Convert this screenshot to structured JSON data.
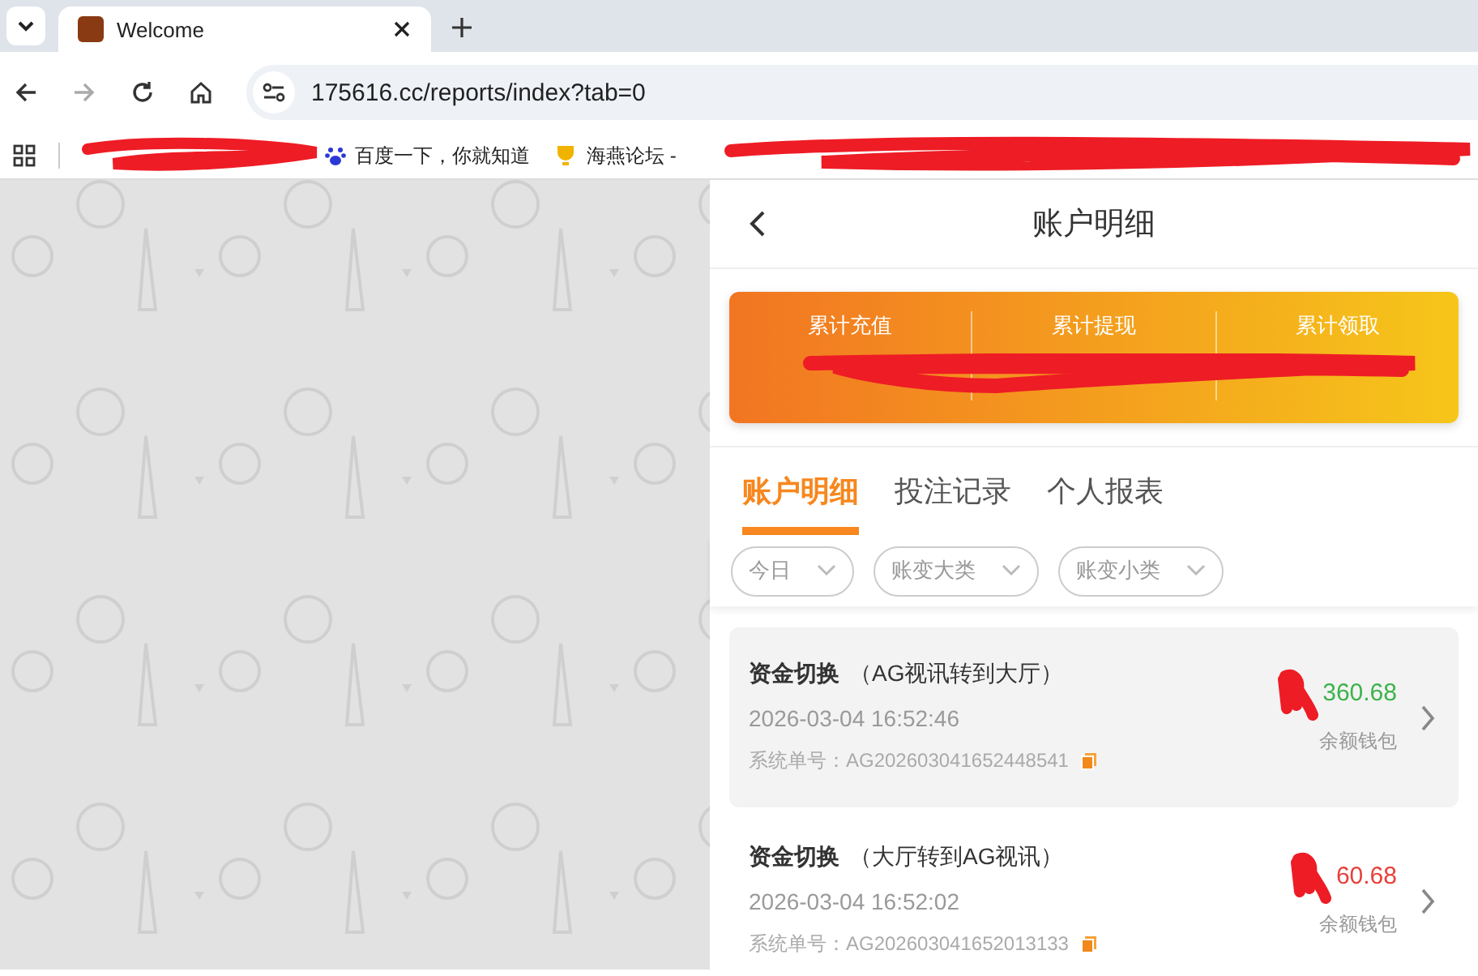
{
  "browser": {
    "tabs": [
      {
        "title": "Welcome",
        "selected": true
      }
    ],
    "url": "175616.cc/reports/index?tab=0",
    "bookmarks": [
      {
        "label": "百度一下，你就知道",
        "kind": "paw"
      },
      {
        "label": "海燕论坛 -",
        "kind": "trophy"
      }
    ]
  },
  "page": {
    "title": "账户明细",
    "summary": [
      {
        "label": "累计充值"
      },
      {
        "label": "累计提现"
      },
      {
        "label": "累计领取"
      }
    ],
    "tabs": [
      {
        "label": "账户明细",
        "selected": true
      },
      {
        "label": "投注记录",
        "selected": false
      },
      {
        "label": "个人报表",
        "selected": false
      }
    ],
    "filters": [
      {
        "label": "今日"
      },
      {
        "label": "账变大类"
      },
      {
        "label": "账变小类"
      }
    ],
    "records": [
      {
        "title": "资金切换",
        "detail": "（AG视讯转到大厅）",
        "time": "2026-03-04 16:52:46",
        "order": "系统单号：AG202603041652448541",
        "amount": "360.68",
        "color": "#3cb34a",
        "wallet": "余额钱包",
        "selected": true
      },
      {
        "title": "资金切换",
        "detail": "（大厅转到AG视讯）",
        "time": "2026-03-04 16:52:02",
        "order": "系统单号：AG202603041652013133",
        "amount": "60.68",
        "color": "#e8403a",
        "wallet": "余额钱包",
        "selected": false
      }
    ]
  }
}
